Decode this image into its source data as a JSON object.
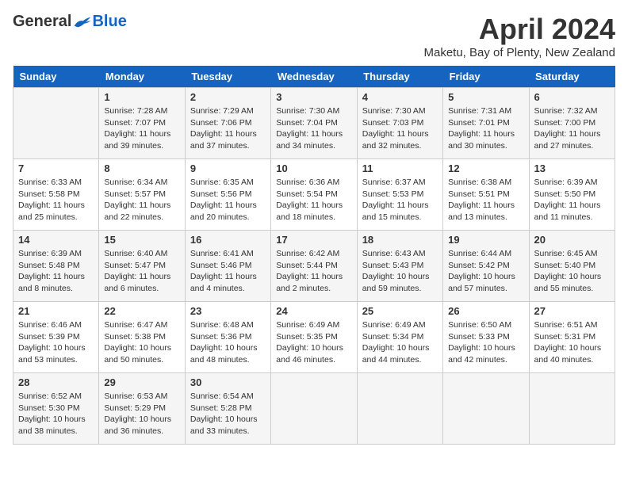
{
  "header": {
    "logo": {
      "general": "General",
      "blue": "Blue"
    },
    "title": "April 2024",
    "location": "Maketu, Bay of Plenty, New Zealand"
  },
  "columns": [
    "Sunday",
    "Monday",
    "Tuesday",
    "Wednesday",
    "Thursday",
    "Friday",
    "Saturday"
  ],
  "weeks": [
    [
      {
        "day": "",
        "info": ""
      },
      {
        "day": "1",
        "info": "Sunrise: 7:28 AM\nSunset: 7:07 PM\nDaylight: 11 hours\nand 39 minutes."
      },
      {
        "day": "2",
        "info": "Sunrise: 7:29 AM\nSunset: 7:06 PM\nDaylight: 11 hours\nand 37 minutes."
      },
      {
        "day": "3",
        "info": "Sunrise: 7:30 AM\nSunset: 7:04 PM\nDaylight: 11 hours\nand 34 minutes."
      },
      {
        "day": "4",
        "info": "Sunrise: 7:30 AM\nSunset: 7:03 PM\nDaylight: 11 hours\nand 32 minutes."
      },
      {
        "day": "5",
        "info": "Sunrise: 7:31 AM\nSunset: 7:01 PM\nDaylight: 11 hours\nand 30 minutes."
      },
      {
        "day": "6",
        "info": "Sunrise: 7:32 AM\nSunset: 7:00 PM\nDaylight: 11 hours\nand 27 minutes."
      }
    ],
    [
      {
        "day": "7",
        "info": "Sunrise: 6:33 AM\nSunset: 5:58 PM\nDaylight: 11 hours\nand 25 minutes."
      },
      {
        "day": "8",
        "info": "Sunrise: 6:34 AM\nSunset: 5:57 PM\nDaylight: 11 hours\nand 22 minutes."
      },
      {
        "day": "9",
        "info": "Sunrise: 6:35 AM\nSunset: 5:56 PM\nDaylight: 11 hours\nand 20 minutes."
      },
      {
        "day": "10",
        "info": "Sunrise: 6:36 AM\nSunset: 5:54 PM\nDaylight: 11 hours\nand 18 minutes."
      },
      {
        "day": "11",
        "info": "Sunrise: 6:37 AM\nSunset: 5:53 PM\nDaylight: 11 hours\nand 15 minutes."
      },
      {
        "day": "12",
        "info": "Sunrise: 6:38 AM\nSunset: 5:51 PM\nDaylight: 11 hours\nand 13 minutes."
      },
      {
        "day": "13",
        "info": "Sunrise: 6:39 AM\nSunset: 5:50 PM\nDaylight: 11 hours\nand 11 minutes."
      }
    ],
    [
      {
        "day": "14",
        "info": "Sunrise: 6:39 AM\nSunset: 5:48 PM\nDaylight: 11 hours\nand 8 minutes."
      },
      {
        "day": "15",
        "info": "Sunrise: 6:40 AM\nSunset: 5:47 PM\nDaylight: 11 hours\nand 6 minutes."
      },
      {
        "day": "16",
        "info": "Sunrise: 6:41 AM\nSunset: 5:46 PM\nDaylight: 11 hours\nand 4 minutes."
      },
      {
        "day": "17",
        "info": "Sunrise: 6:42 AM\nSunset: 5:44 PM\nDaylight: 11 hours\nand 2 minutes."
      },
      {
        "day": "18",
        "info": "Sunrise: 6:43 AM\nSunset: 5:43 PM\nDaylight: 10 hours\nand 59 minutes."
      },
      {
        "day": "19",
        "info": "Sunrise: 6:44 AM\nSunset: 5:42 PM\nDaylight: 10 hours\nand 57 minutes."
      },
      {
        "day": "20",
        "info": "Sunrise: 6:45 AM\nSunset: 5:40 PM\nDaylight: 10 hours\nand 55 minutes."
      }
    ],
    [
      {
        "day": "21",
        "info": "Sunrise: 6:46 AM\nSunset: 5:39 PM\nDaylight: 10 hours\nand 53 minutes."
      },
      {
        "day": "22",
        "info": "Sunrise: 6:47 AM\nSunset: 5:38 PM\nDaylight: 10 hours\nand 50 minutes."
      },
      {
        "day": "23",
        "info": "Sunrise: 6:48 AM\nSunset: 5:36 PM\nDaylight: 10 hours\nand 48 minutes."
      },
      {
        "day": "24",
        "info": "Sunrise: 6:49 AM\nSunset: 5:35 PM\nDaylight: 10 hours\nand 46 minutes."
      },
      {
        "day": "25",
        "info": "Sunrise: 6:49 AM\nSunset: 5:34 PM\nDaylight: 10 hours\nand 44 minutes."
      },
      {
        "day": "26",
        "info": "Sunrise: 6:50 AM\nSunset: 5:33 PM\nDaylight: 10 hours\nand 42 minutes."
      },
      {
        "day": "27",
        "info": "Sunrise: 6:51 AM\nSunset: 5:31 PM\nDaylight: 10 hours\nand 40 minutes."
      }
    ],
    [
      {
        "day": "28",
        "info": "Sunrise: 6:52 AM\nSunset: 5:30 PM\nDaylight: 10 hours\nand 38 minutes."
      },
      {
        "day": "29",
        "info": "Sunrise: 6:53 AM\nSunset: 5:29 PM\nDaylight: 10 hours\nand 36 minutes."
      },
      {
        "day": "30",
        "info": "Sunrise: 6:54 AM\nSunset: 5:28 PM\nDaylight: 10 hours\nand 33 minutes."
      },
      {
        "day": "",
        "info": ""
      },
      {
        "day": "",
        "info": ""
      },
      {
        "day": "",
        "info": ""
      },
      {
        "day": "",
        "info": ""
      }
    ]
  ]
}
